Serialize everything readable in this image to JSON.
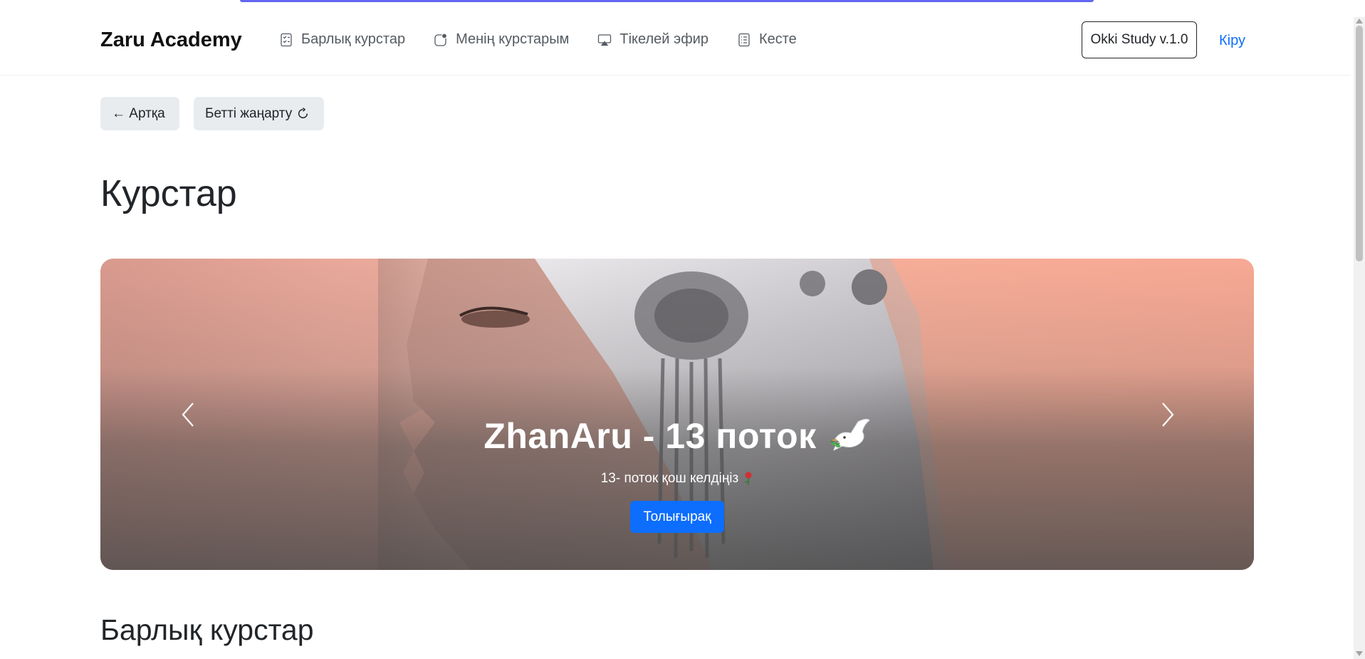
{
  "navbar": {
    "brand": "Zaru Academy",
    "links": [
      {
        "label": "Барлық курстар",
        "icon": "checklist-icon"
      },
      {
        "label": "Менің курстарым",
        "icon": "notification-dot-icon"
      },
      {
        "label": "Тікелей эфир",
        "icon": "airplay-icon"
      },
      {
        "label": "Кесте",
        "icon": "schedule-list-icon"
      }
    ],
    "version_label": "Okki Study v.1.0",
    "login_label": "Кіру"
  },
  "actions": {
    "back_label": "← Артқа",
    "refresh_label": "Бетті жаңарту"
  },
  "page": {
    "title": "Курстар",
    "section_title": "Барлық курстар"
  },
  "carousel": {
    "slide": {
      "title": "ZhanAru - 13 поток",
      "subtitle": "13- поток қош келдіңіз",
      "button_label": "Толығырақ"
    }
  },
  "colors": {
    "accent": "#0d6efd",
    "top_bar": "#6366f1",
    "button_bg": "#e9ecef"
  }
}
